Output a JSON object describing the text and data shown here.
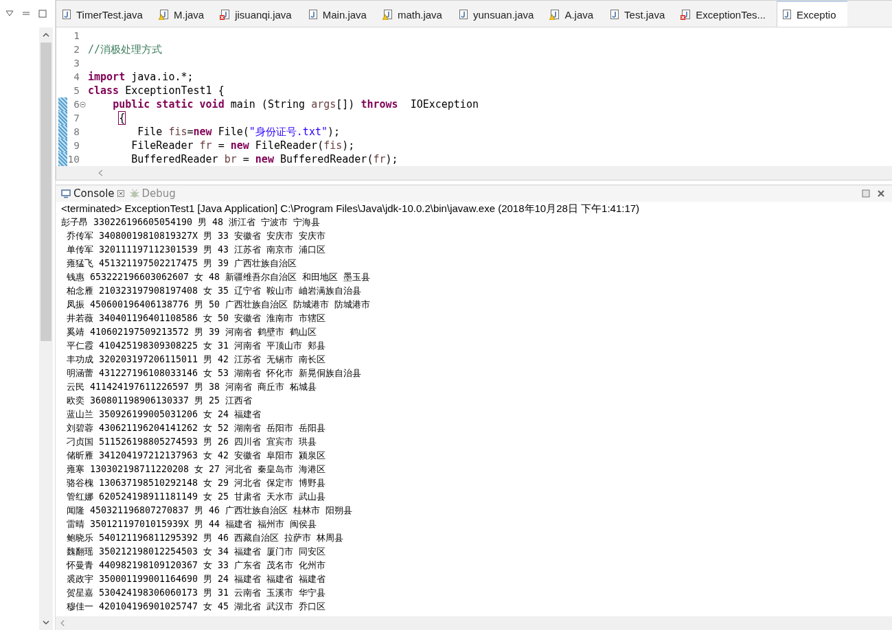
{
  "editor": {
    "tabs": [
      {
        "label": "TimerTest.java",
        "kind": "plain",
        "selected": false
      },
      {
        "label": "M.java",
        "kind": "warning",
        "selected": false
      },
      {
        "label": "jisuanqi.java",
        "kind": "error",
        "selected": false
      },
      {
        "label": "Main.java",
        "kind": "plain",
        "selected": false
      },
      {
        "label": "math.java",
        "kind": "warning",
        "selected": false
      },
      {
        "label": "yunsuan.java",
        "kind": "plain",
        "selected": false
      },
      {
        "label": "A.java",
        "kind": "warning",
        "selected": false
      },
      {
        "label": "Test.java",
        "kind": "plain",
        "selected": false
      },
      {
        "label": "ExceptionTes...",
        "kind": "error",
        "selected": false
      },
      {
        "label": "Exceptio",
        "kind": "plain",
        "selected": true
      }
    ],
    "lines": [
      {
        "number": "1",
        "foldable": false,
        "changed": false
      },
      {
        "number": "2",
        "foldable": false,
        "changed": false,
        "segments": [
          {
            "text": "//消极处理方式",
            "kind": "comment"
          }
        ]
      },
      {
        "number": "3",
        "foldable": false,
        "changed": false
      },
      {
        "number": "4",
        "foldable": false,
        "changed": false,
        "segments": [
          {
            "text": "import",
            "kind": "keyword"
          },
          {
            "text": " java.io.*;",
            "kind": "plain"
          }
        ]
      },
      {
        "number": "5",
        "foldable": false,
        "changed": false,
        "segments": [
          {
            "text": "class",
            "kind": "keyword"
          },
          {
            "text": " ExceptionTest1 {",
            "kind": "plain"
          }
        ]
      },
      {
        "number": "6",
        "foldable": true,
        "changed": true,
        "segments": [
          {
            "text": "    public static void",
            "kind": "keyword"
          },
          {
            "text": " main (String ",
            "kind": "plain"
          },
          {
            "text": "args",
            "kind": "variable"
          },
          {
            "text": "[]) ",
            "kind": "plain"
          },
          {
            "text": "throws",
            "kind": "keyword"
          },
          {
            "text": "  IOException",
            "kind": "plain"
          }
        ]
      },
      {
        "number": "7",
        "foldable": false,
        "changed": true,
        "segments": [
          {
            "text": "     {",
            "kind": "matched-bracket"
          }
        ]
      },
      {
        "number": "8",
        "foldable": false,
        "changed": true,
        "segments": [
          {
            "text": "        File ",
            "kind": "plain"
          },
          {
            "text": "fis",
            "kind": "variable"
          },
          {
            "text": "=",
            "kind": "plain"
          },
          {
            "text": "new",
            "kind": "keyword"
          },
          {
            "text": " File(",
            "kind": "plain"
          },
          {
            "text": "\"身份证号.txt\"",
            "kind": "string"
          },
          {
            "text": ");",
            "kind": "plain"
          }
        ]
      },
      {
        "number": "9",
        "foldable": false,
        "changed": true,
        "segments": [
          {
            "text": "       FileReader ",
            "kind": "plain"
          },
          {
            "text": "fr",
            "kind": "variable"
          },
          {
            "text": " = ",
            "kind": "plain"
          },
          {
            "text": "new",
            "kind": "keyword"
          },
          {
            "text": " FileReader(",
            "kind": "plain"
          },
          {
            "text": "fis",
            "kind": "variable"
          },
          {
            "text": ");",
            "kind": "plain"
          }
        ]
      },
      {
        "number": "10",
        "foldable": false,
        "changed": true,
        "segments": [
          {
            "text": "       BufferedReader ",
            "kind": "plain"
          },
          {
            "text": "br",
            "kind": "variable"
          },
          {
            "text": " = ",
            "kind": "plain"
          },
          {
            "text": "new",
            "kind": "keyword"
          },
          {
            "text": " BufferedReader(",
            "kind": "plain"
          },
          {
            "text": "fr",
            "kind": "variable"
          },
          {
            "text": ");",
            "kind": "plain"
          }
        ]
      }
    ]
  },
  "console": {
    "tabs": [
      {
        "label": "Console",
        "kind": "console",
        "selected": true
      },
      {
        "label": "Debug",
        "kind": "debug",
        "selected": false
      }
    ],
    "status": "<terminated> ExceptionTest1 [Java Application] C:\\Program Files\\Java\\jdk-10.0.2\\bin\\javaw.exe (2018年10月28日 下午1:41:17)",
    "output": [
      "彭子昂 330226196605054190 男 48 浙江省 宁波市 宁海县",
      " 乔传军 34080019810819327X 男 33 安徽省 安庆市 安庆市",
      " 单传军 320111197112301539 男 43 江苏省 南京市 浦口区",
      " 雍猛飞 451321197502217475 男 39 广西壮族自治区",
      " 钱惠 653222196603062607 女 48 新疆维吾尔自治区 和田地区 墨玉县",
      " 柏念雁 210323197908197408 女 35 辽宁省 鞍山市 岫岩满族自治县",
      " 凤振 450600196406138776 男 50 广西壮族自治区 防城港市 防城港市",
      " 井若薇 340401196401108586 女 50 安徽省 淮南市 市辖区",
      " 奚靖 410602197509213572 男 39 河南省 鹤壁市 鹤山区",
      " 平仁霞 410425198309308225 女 31 河南省 平顶山市 郏县",
      " 丰功成 320203197206115011 男 42 江苏省 无锡市 南长区",
      " 明涵蕾 431227196108033146 女 53 湖南省 怀化市 新晃侗族自治县",
      " 云民 411424197611226597 男 38 河南省 商丘市 柘城县",
      " 欧奕 360801198906130337 男 25 江西省",
      " 蓝山兰 350926199005031206 女 24 福建省",
      " 刘碧蓉 430621196204141262 女 52 湖南省 岳阳市 岳阳县",
      " 刁贞国 511526198805274593 男 26 四川省 宜宾市 珙县",
      " 储昕雁 341204197212137963 女 42 安徽省 阜阳市 颍泉区",
      " 雍寒 130302198711220208 女 27 河北省 秦皇岛市 海港区",
      " 骆谷槐 130637198510292148 女 29 河北省 保定市 博野县",
      " 管红娜 620524198911181149 女 25 甘肃省 天水市 武山县",
      " 闻隆 450321196807270837 男 46 广西壮族自治区 桂林市 阳朔县",
      " 雷晴 35012119701015939X 男 44 福建省 福州市 闽侯县",
      " 鲍晓乐 540121196811295392 男 46 西藏自治区 拉萨市 林周县",
      " 魏翻瑶 350212198012254503 女 34 福建省 厦门市 同安区",
      " 怀曼青 440982198109120367 女 33 广东省 茂名市 化州市",
      " 裘政宇 350001199001164690 男 24 福建省 福建省 福建省",
      " 贺星嘉 530424198306060173 男 31 云南省 玉溪市 华宁县",
      " 穆佳一 420104196901025747 女 45 湖北省 武汉市 乔口区"
    ]
  }
}
